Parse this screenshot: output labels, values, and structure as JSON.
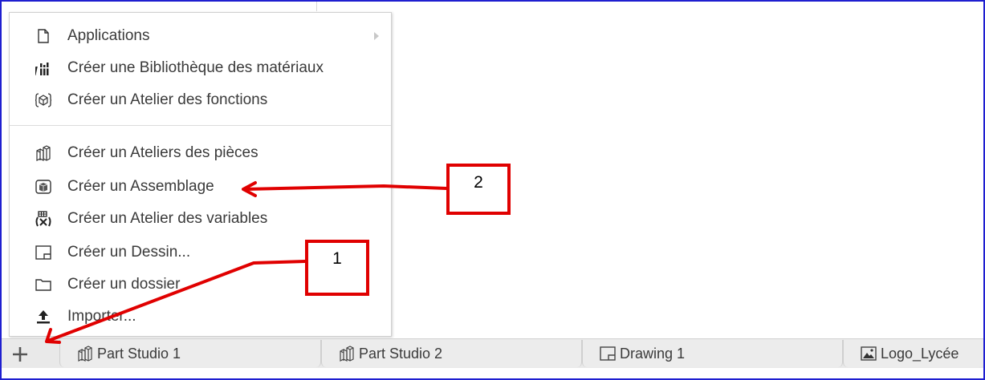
{
  "menu": {
    "items": [
      {
        "label": "Applications",
        "icon": "document-icon",
        "submenu": true
      },
      {
        "label": "Créer une Bibliothèque des matériaux",
        "icon": "material-library-icon"
      },
      {
        "label": "Créer un Atelier des fonctions",
        "icon": "feature-studio-icon"
      },
      {
        "label": "Créer un Ateliers des pièces",
        "icon": "part-studio-icon"
      },
      {
        "label": "Créer un Assemblage",
        "icon": "assembly-icon"
      },
      {
        "label": "Créer un Atelier des variables",
        "icon": "variable-studio-icon"
      },
      {
        "label": "Créer un Dessin...",
        "icon": "drawing-icon"
      },
      {
        "label": "Créer un dossier",
        "icon": "folder-icon"
      },
      {
        "label": "Importer...",
        "icon": "upload-icon"
      }
    ]
  },
  "tabs": [
    {
      "label": "Part Studio 1",
      "icon": "part-studio-icon"
    },
    {
      "label": "Part Studio 2",
      "icon": "part-studio-icon"
    },
    {
      "label": "Drawing 1",
      "icon": "drawing-icon"
    },
    {
      "label": "Logo_Lycée",
      "icon": "image-icon"
    }
  ],
  "callouts": [
    {
      "label": "1"
    },
    {
      "label": "2"
    }
  ],
  "colors": {
    "annotation": "#e00000",
    "frame": "#1f1fd0",
    "tabbar": "#e9e9e9"
  }
}
